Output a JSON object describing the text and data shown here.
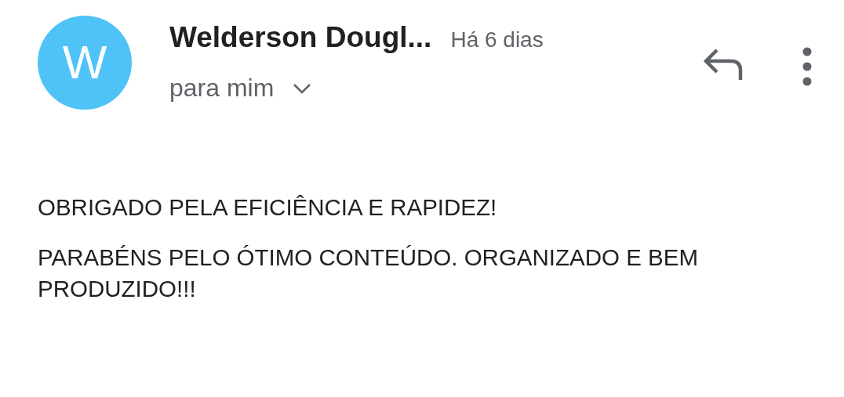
{
  "sender": {
    "initial": "W",
    "name": "Welderson Dougl...",
    "time": "Há 6 dias",
    "recipient": "para mim",
    "details_expanded": false
  },
  "body": [
    "OBRIGADO PELA EFICIÊNCIA E RAPIDEZ!",
    "PARABÉNS PELO ÓTIMO CONTEÚDO. ORGANIZADO E BEM PRODUZIDO!!!"
  ]
}
